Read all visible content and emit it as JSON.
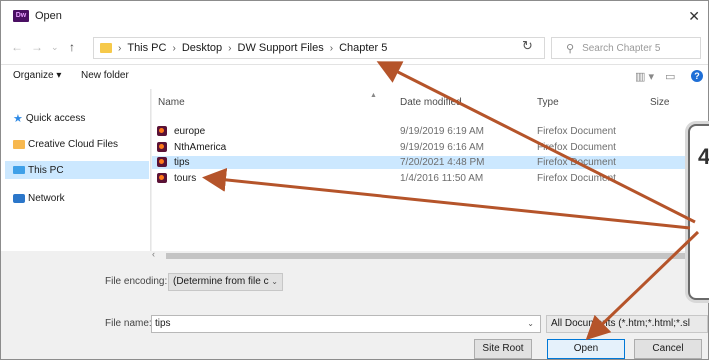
{
  "window": {
    "title": "Open",
    "app_badge": "Dw",
    "close": "✕"
  },
  "address": {
    "crumbs": [
      "This PC",
      "Desktop",
      "DW Support Files",
      "Chapter 5"
    ],
    "search_placeholder": "Search Chapter 5"
  },
  "toolbar": {
    "organize": "Organize ▾",
    "new_folder": "New folder"
  },
  "nav": {
    "items": [
      {
        "label": "Quick access",
        "icon": "star-icon"
      },
      {
        "label": "Creative Cloud Files",
        "icon": "folder-icon"
      },
      {
        "label": "This PC",
        "icon": "computer-icon",
        "selected": true
      },
      {
        "label": "Network",
        "icon": "network-icon"
      }
    ]
  },
  "files": {
    "columns": {
      "name": "Name",
      "date": "Date modified",
      "type": "Type",
      "size": "Size"
    },
    "rows": [
      {
        "name": "europe",
        "date": "9/19/2019 6:19 AM",
        "type": "Firefox Document"
      },
      {
        "name": "NthAmerica",
        "date": "9/19/2019 6:16 AM",
        "type": "Firefox Document"
      },
      {
        "name": "tips",
        "date": "7/20/2021 4:48 PM",
        "type": "Firefox Document",
        "selected": true
      },
      {
        "name": "tours",
        "date": "1/4/2016 11:50 AM",
        "type": "Firefox Document"
      }
    ]
  },
  "bottom": {
    "encoding_label": "File encoding:",
    "encoding_value": "(Determine from file c",
    "filename_label": "File name:",
    "filename_value": "tips",
    "filter_value": "All Documents (*.htm;*.html;*.sl",
    "site_root": "Site Root",
    "open": "Open",
    "cancel": "Cancel"
  },
  "callout": {
    "text": "4"
  },
  "colors": {
    "arrow": "#b5542a",
    "selection": "#cce8ff",
    "accent": "#0078d7"
  }
}
